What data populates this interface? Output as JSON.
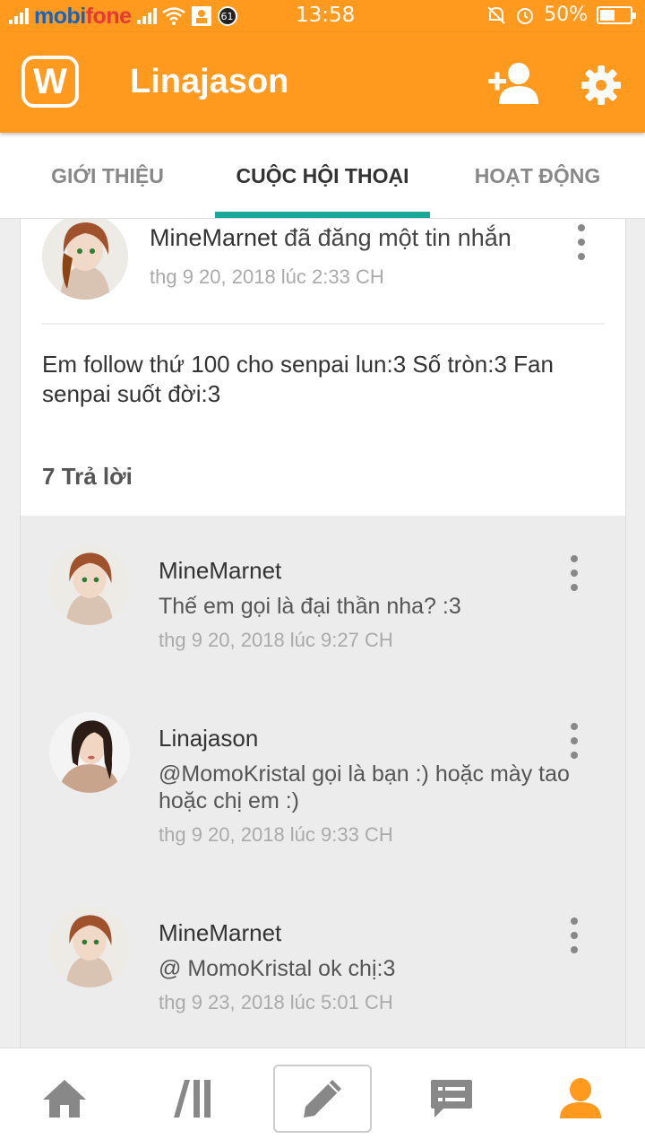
{
  "status_bar": {
    "carrier_part1": "mobi",
    "carrier_part2": "fone",
    "badge": "61",
    "time": "13:58",
    "battery_percent": "50%",
    "battery_level": 0.5
  },
  "app_bar": {
    "logo_letter": "W",
    "title": "Linajason",
    "icons": [
      "add-user-icon",
      "settings-gear-icon"
    ]
  },
  "tabs": [
    {
      "label": "GIỚI THIỆU",
      "active": false
    },
    {
      "label": "CUỘC HỘI THOẠI",
      "active": true
    },
    {
      "label": "HOẠT ĐỘNG",
      "active": false
    }
  ],
  "colors": {
    "primary": "#ff9a1f",
    "tab_indicator": "#1aa89b",
    "active_nav": "#ff9a1f"
  },
  "post": {
    "author": "MineMarnet",
    "action": " đã đăng một tin nhắn",
    "date": "thg 9 20, 2018 lúc 2:33 CH",
    "body": "Em follow thứ 100 cho senpai lun:3 Số tròn:3 Fan senpai suốt đời:3",
    "reply_count": "7 Trả lời"
  },
  "replies": [
    {
      "author": "MineMarnet",
      "text": "Thế em gọi là đại thần nha? :3",
      "date": "thg 9 20, 2018 lúc 9:27 CH"
    },
    {
      "author": "Linajason",
      "text": "@MomoKristal  gọi là bạn :) hoặc mày tao hoặc chị em :)",
      "date": "thg 9 20, 2018 lúc 9:33 CH"
    },
    {
      "author": "MineMarnet",
      "text": "@ MomoKristal  ok chị:3",
      "date": "thg 9 23, 2018 lúc 5:01 CH"
    }
  ],
  "bottom_nav": [
    {
      "name": "home-icon"
    },
    {
      "name": "library-icon"
    },
    {
      "name": "write-pencil-icon"
    },
    {
      "name": "messages-icon"
    },
    {
      "name": "profile-icon",
      "active": true
    }
  ]
}
